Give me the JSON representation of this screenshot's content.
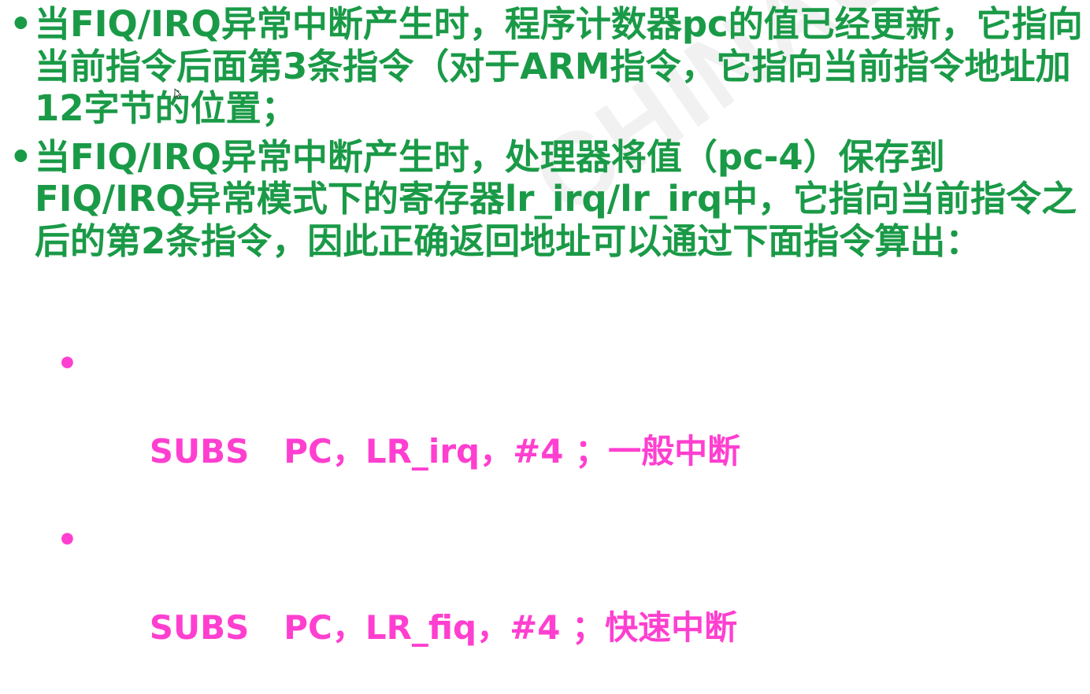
{
  "watermark": {
    "text": "CHINAUNIX"
  },
  "bullets": [
    {
      "text": "当FIQ/IRQ异常中断产生时，程序计数器pc的值已经更新，它指向当前指令后面第3条指令（对于ARM指令，它指向当前指令地址加12字节的位置；"
    },
    {
      "text": "当FIQ/IRQ异常中断产生时，处理器将值（pc-4）保存到FIQ/IRQ异常模式下的寄存器lr_irq/lr_irq中，它指向当前指令之后的第2条指令，因此正确返回地址可以通过下面指令算出："
    }
  ],
  "code_lines": [
    {
      "text": "SUBS   PC，LR_irq，#4 ；一般中断"
    },
    {
      "text": "SUBS   PC，LR_fiq，#4 ；快速中断"
    }
  ],
  "bullet_glyph": "•",
  "colors": {
    "bullet_text": "#1a9a47",
    "code_text": "#ff3fd0",
    "background": "#ffffff"
  },
  "icons": {
    "cursor": "mouse-pointer-icon"
  }
}
